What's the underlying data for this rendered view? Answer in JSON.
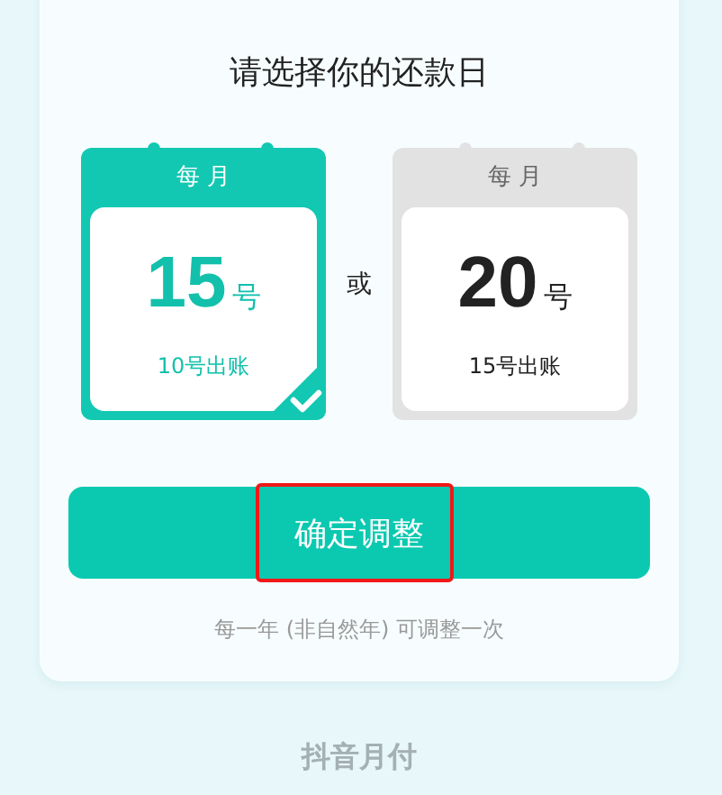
{
  "title": "请选择你的还款日",
  "options": [
    {
      "header": "每 月",
      "day": "15",
      "unit": "号",
      "bill": "10号出账",
      "selected": true
    },
    {
      "header": "每 月",
      "day": "20",
      "unit": "号",
      "bill": "15号出账",
      "selected": false
    }
  ],
  "separator": "或",
  "confirm_button": "确定调整",
  "note": "每一年 (非自然年) 可调整一次",
  "footer": "抖音月付"
}
